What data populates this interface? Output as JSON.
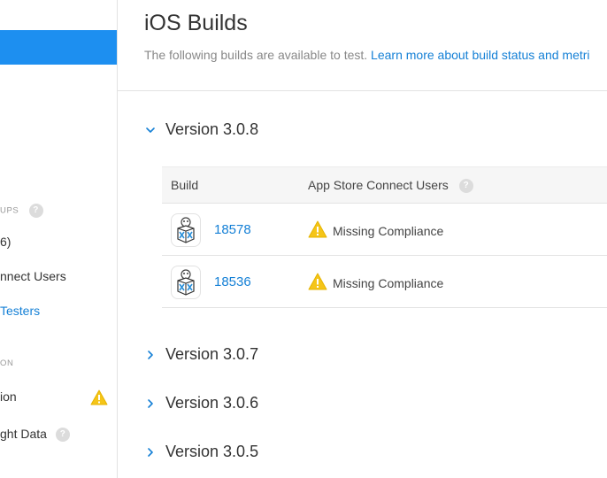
{
  "sidebar": {
    "section_groups_label": "UPS",
    "item_count_fragment": "6)",
    "item_connect_users": "nnect Users",
    "item_testers": "Testers",
    "section_info_label": "ON",
    "item_information": "ion",
    "item_insight_data": "ght Data",
    "help_glyph": "?"
  },
  "header": {
    "title": "iOS Builds",
    "subtitle": "The following builds are available to test.",
    "learn_more_link": "Learn more about build status and metri"
  },
  "versions_expanded": {
    "label": "Version 3.0.8",
    "table": {
      "col_build": "Build",
      "col_users": "App Store Connect Users",
      "rows": [
        {
          "build": "18578",
          "status": "Missing Compliance"
        },
        {
          "build": "18536",
          "status": "Missing Compliance"
        }
      ]
    }
  },
  "versions_collapsed": [
    {
      "label": "Version 3.0.7"
    },
    {
      "label": "Version 3.0.6"
    },
    {
      "label": "Version 3.0.5"
    }
  ],
  "colors": {
    "accent": "#1d8ff0",
    "link": "#1580d6",
    "warning": "#f5c518"
  }
}
